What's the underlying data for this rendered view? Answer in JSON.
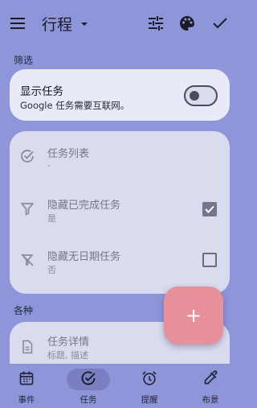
{
  "appbar": {
    "title": "行程"
  },
  "sections": {
    "filter": "筛选",
    "misc": "各种"
  },
  "show_tasks": {
    "title": "显示任务",
    "subtitle": "Google 任务需要互联网。",
    "enabled": false
  },
  "task_settings": [
    {
      "title": "任务列表",
      "subtitle": "-",
      "icon": "check-circle-icon"
    },
    {
      "title": "隐藏已完成任务",
      "subtitle": "是",
      "icon": "filter-icon",
      "checked": true
    },
    {
      "title": "隐藏无日期任务",
      "subtitle": "否",
      "icon": "calendar-off-icon",
      "checked": false
    }
  ],
  "misc": [
    {
      "title": "任务详情",
      "subtitle": "标题, 描述",
      "icon": "document-icon"
    }
  ],
  "fab": {
    "label": "+"
  },
  "nav": [
    {
      "label": "事件",
      "icon": "calendar-icon"
    },
    {
      "label": "任务",
      "icon": "task-check-icon",
      "active": true
    },
    {
      "label": "提醒",
      "icon": "alarm-icon"
    },
    {
      "label": "布景",
      "icon": "eyedropper-icon"
    }
  ],
  "colors": {
    "background": "#8f95d9",
    "card": "#d9dbef",
    "card_top": "#e9eaf7",
    "fab": "#e5909a",
    "active_pill": "#7b7fc2"
  }
}
